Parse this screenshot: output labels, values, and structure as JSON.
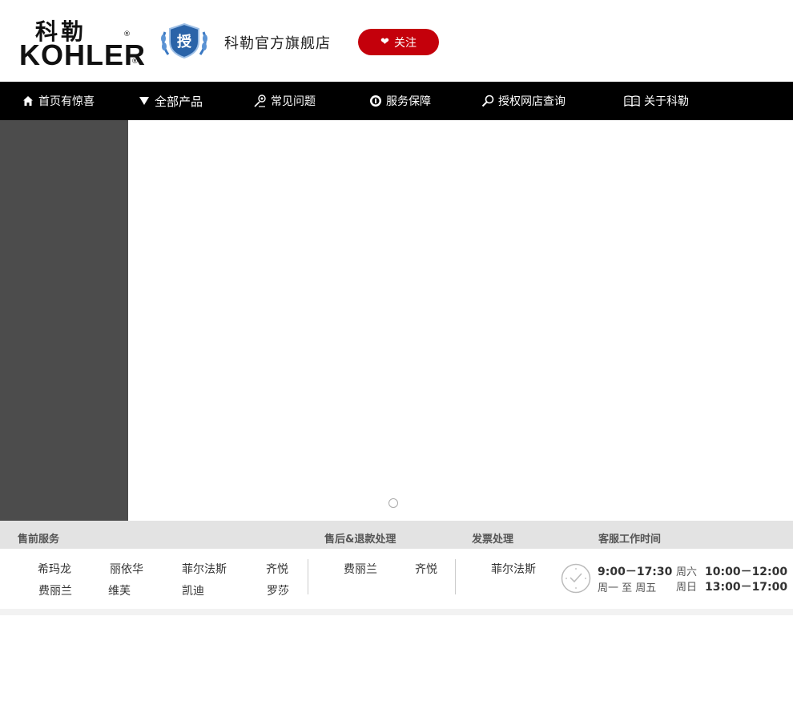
{
  "header": {
    "logo_cn": "科勒",
    "logo_en": "KOHLER",
    "logo_reg": "®",
    "badge_char": "授",
    "store_name": "科勒官方旗舰店",
    "follow_label": "关注",
    "follow_icon": "heart-icon",
    "brand_color": "#c4000b"
  },
  "nav": {
    "items": [
      {
        "label": "首页有惊喜",
        "icon": "home-icon"
      },
      {
        "label": "全部产品",
        "icon": "triangle-down-icon"
      },
      {
        "label": "常见问题",
        "icon": "question-person-icon"
      },
      {
        "label": "服务保障",
        "icon": "service-badge-icon"
      },
      {
        "label": "授权网店查询",
        "icon": "search-icon"
      },
      {
        "label": "关于科勒",
        "icon": "book-icon"
      }
    ]
  },
  "service": {
    "headers": {
      "presale": "售前服务",
      "aftersale": "售后&退款处理",
      "invoice": "发票处理",
      "hours": "客服工作时间"
    },
    "presale_agents": [
      "希玛龙",
      "丽依华",
      "菲尔法斯",
      "齐悦",
      "费丽兰",
      "维芙",
      "凯迪",
      "罗莎"
    ],
    "aftersale_agents": [
      "费丽兰",
      "齐悦"
    ],
    "invoice_agents": [
      "菲尔法斯"
    ],
    "hours": {
      "weekday_time": "9:00－17:30",
      "weekday_label": "周一 至 周五",
      "sat_label": "周六",
      "sat_time": "10:00－12:00",
      "sun_label": "周日",
      "sun_time": "13:00－17:00"
    }
  }
}
